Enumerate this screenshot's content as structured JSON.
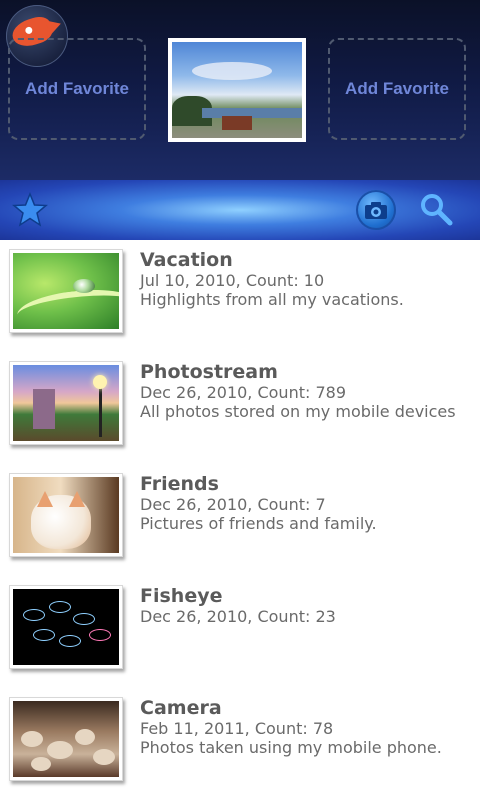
{
  "favorites": {
    "left_label": "Add Favorite",
    "right_label": "Add Favorite"
  },
  "toolbar": {
    "star_icon": "star-icon",
    "camera_icon": "camera-icon",
    "search_icon": "search-icon"
  },
  "albums": [
    {
      "title": "Vacation",
      "subtitle": "Jul 10, 2010, Count: 10",
      "description": "Highlights from all my vacations."
    },
    {
      "title": "Photostream",
      "subtitle": "Dec 26, 2010, Count: 789",
      "description": "All photos stored on my mobile devices"
    },
    {
      "title": "Friends",
      "subtitle": "Dec 26, 2010, Count: 7",
      "description": "Pictures of friends and family."
    },
    {
      "title": "Fisheye",
      "subtitle": "Dec 26, 2010, Count: 23",
      "description": ""
    },
    {
      "title": "Camera",
      "subtitle": "Feb 11, 2011, Count: 78",
      "description": "Photos taken using my mobile phone."
    }
  ],
  "colors": {
    "accent": "#3f7ee0",
    "favorite_label": "#6f86d8",
    "list_text": "#5a5a5a"
  }
}
